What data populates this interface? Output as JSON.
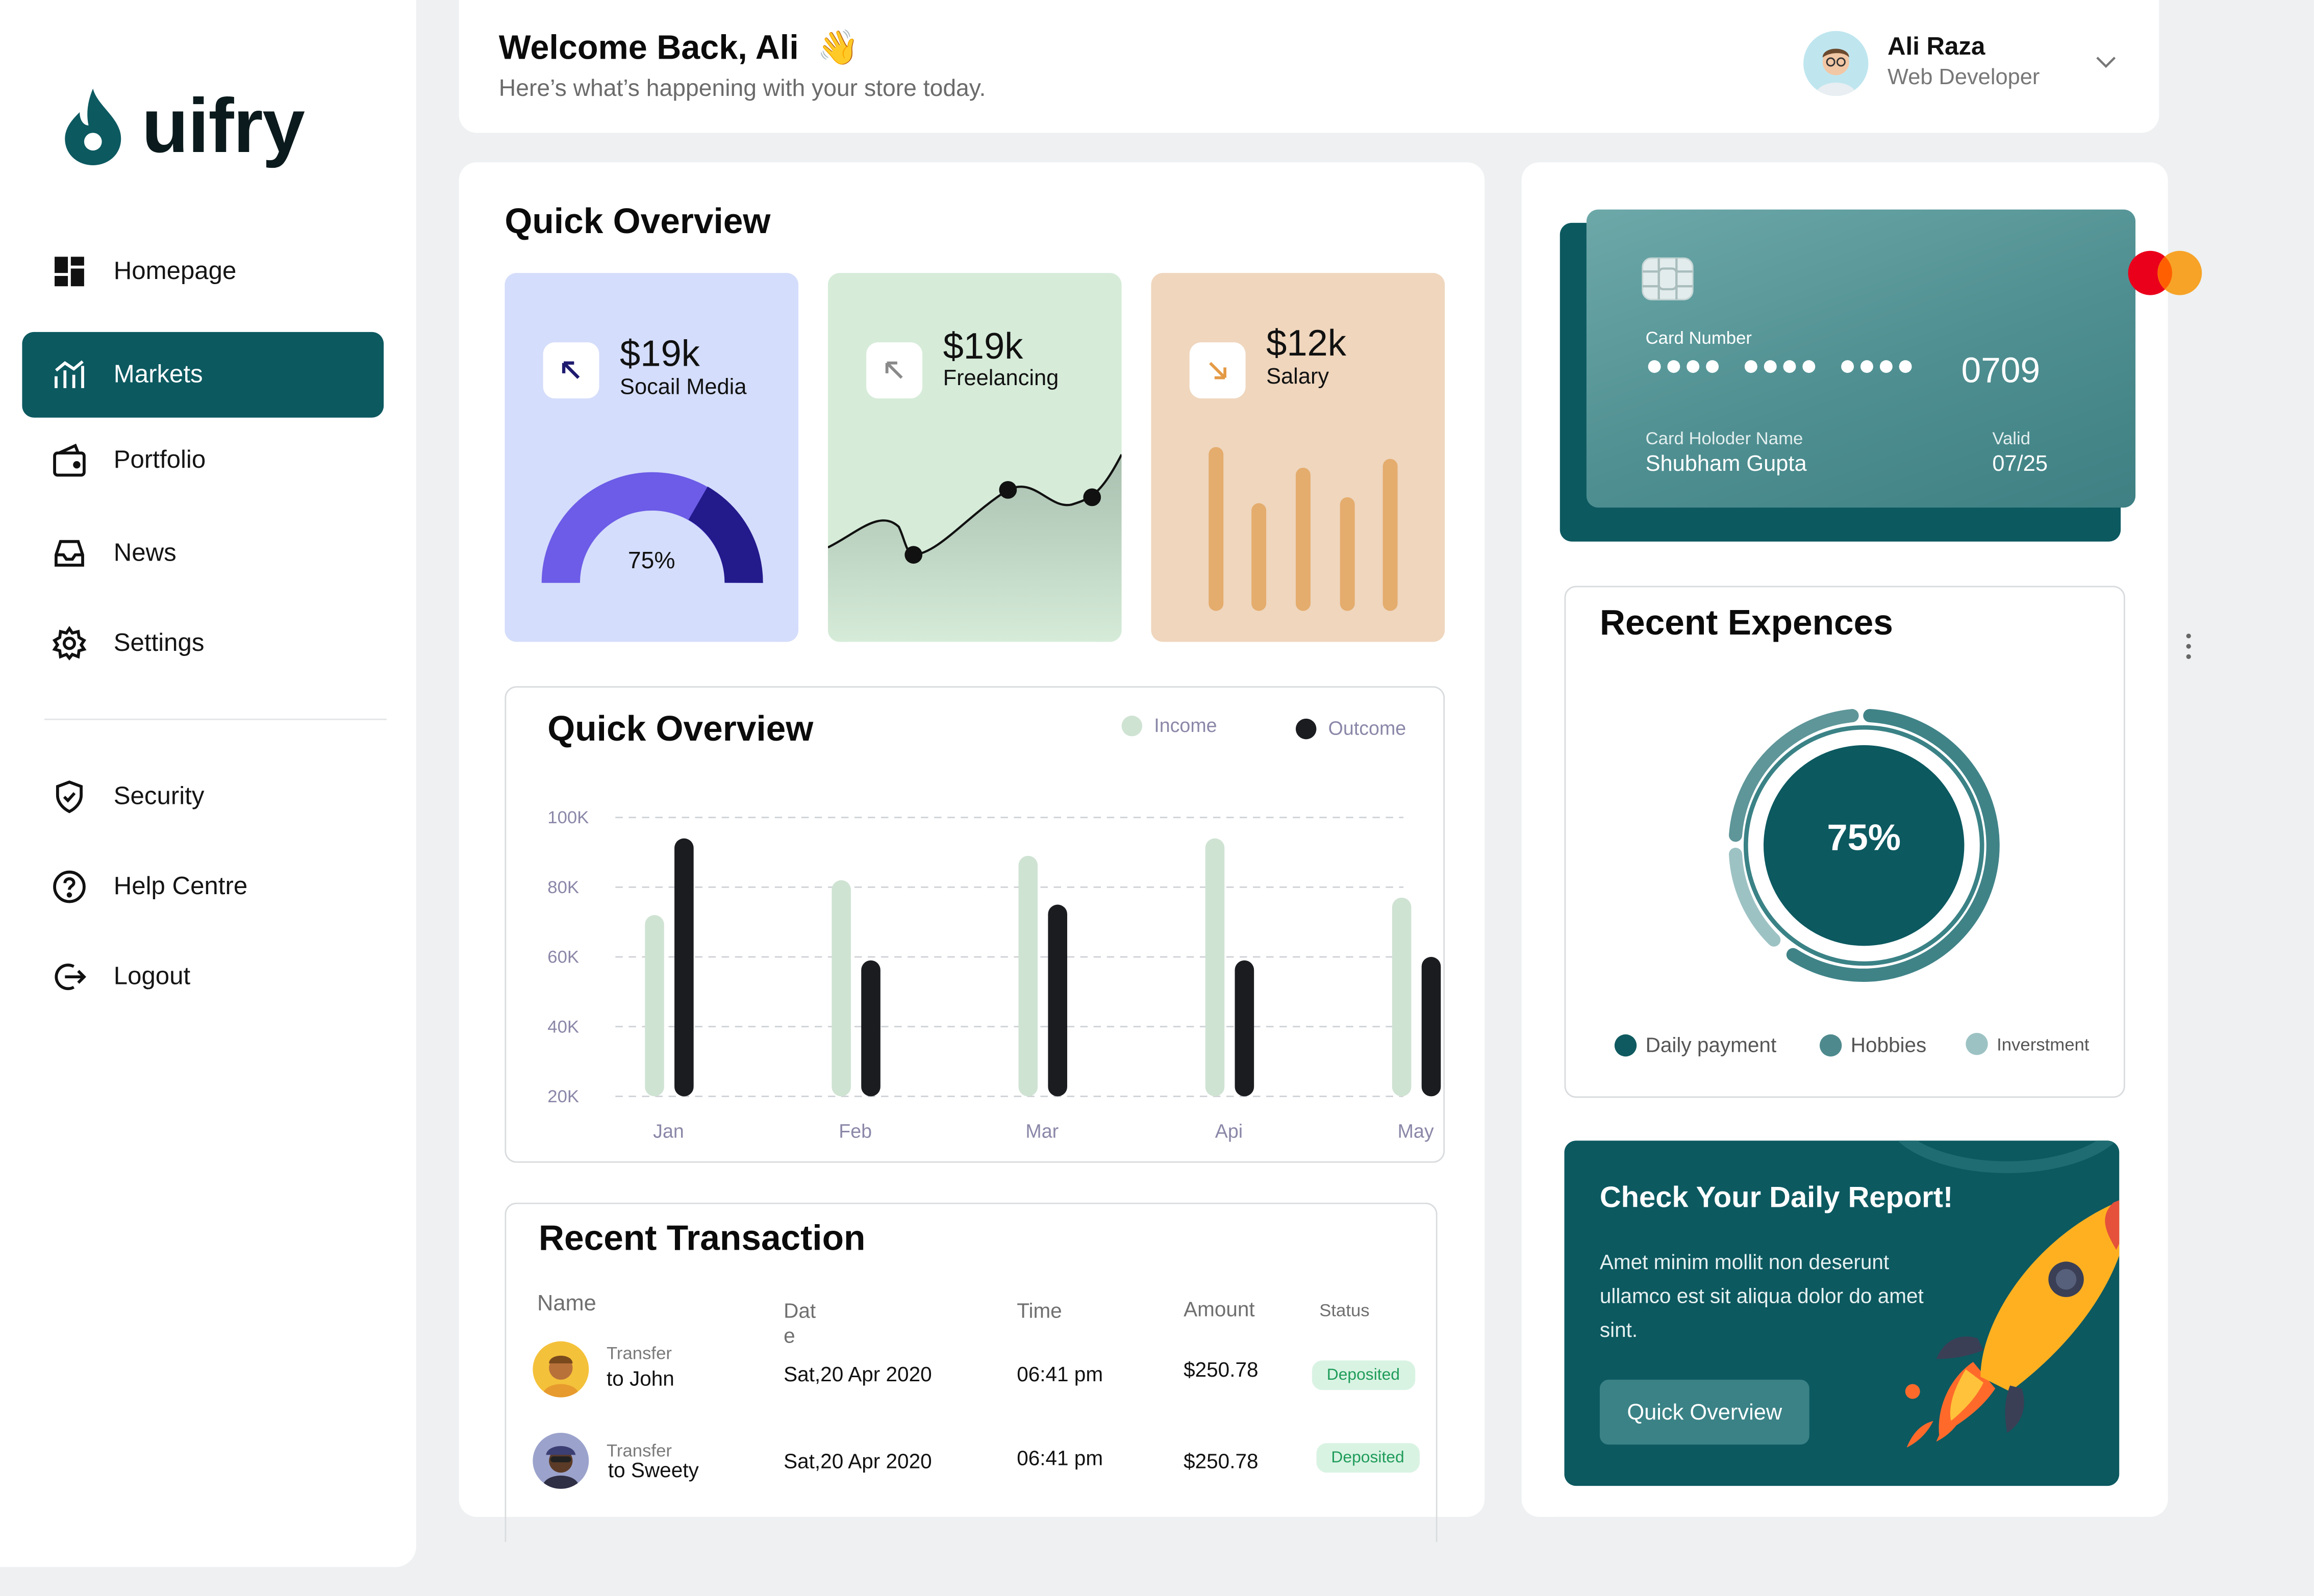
{
  "brand": {
    "name": "uifry"
  },
  "sidebar": {
    "items": [
      {
        "label": "Homepage",
        "icon": "grid-icon"
      },
      {
        "label": "Markets",
        "icon": "chart-icon",
        "active": true
      },
      {
        "label": "Portfolio",
        "icon": "wallet-icon"
      },
      {
        "label": "News",
        "icon": "inbox-icon"
      },
      {
        "label": "Settings",
        "icon": "gear-icon"
      },
      {
        "label": "Security",
        "icon": "shield-icon"
      },
      {
        "label": "Help Centre",
        "icon": "help-icon"
      },
      {
        "label": "Logout",
        "icon": "logout-icon"
      }
    ]
  },
  "header": {
    "welcome": "Welcome Back, Ali",
    "wave": "👋",
    "subtitle": "Here’s what’s happening with your store today.",
    "user": {
      "name": "Ali Raza",
      "role": "Web Developer"
    }
  },
  "overview": {
    "title": "Quick Overview",
    "cards": [
      {
        "value": "$19k",
        "label": "Socail Media",
        "gauge": "75%",
        "bg": "#d4ddfb"
      },
      {
        "value": "$19k",
        "label": "Freelancing",
        "bg": "#d6ecd9"
      },
      {
        "value": "$12k",
        "label": "Salary",
        "bg": "#efd6bd"
      }
    ]
  },
  "chart_data": {
    "type": "bar",
    "title": "Quick Overview",
    "categories": [
      "Jan",
      "Feb",
      "Mar",
      "Api",
      "May"
    ],
    "series": [
      {
        "name": "Income",
        "color": "#cfe3d3",
        "values": [
          72000,
          82000,
          89000,
          94000,
          77000
        ]
      },
      {
        "name": "Outcome",
        "color": "#1a1c20",
        "values": [
          94000,
          59000,
          75000,
          59000,
          60000
        ]
      }
    ],
    "yticks": [
      "100K",
      "80K",
      "60K",
      "40K",
      "20K"
    ],
    "ylim": [
      20000,
      100000
    ],
    "grid": true,
    "legend": "top-right"
  },
  "transactions": {
    "title": "Recent Transaction",
    "headers": {
      "name": "Name",
      "date": "Dat\ne",
      "time": "Time",
      "amount": "Amount",
      "status": "Status"
    },
    "rows": [
      {
        "prefix": "Transfer",
        "name": "to John",
        "date": "Sat,20 Apr 2020",
        "time": "06:41 pm",
        "amount": "$250.78",
        "status": "Deposited"
      },
      {
        "prefix": "Transfer",
        "name": "to Sweety",
        "date": "Sat,20 Apr 2020",
        "time": "06:41 pm",
        "amount": "$250.78",
        "status": "Deposited"
      }
    ]
  },
  "card": {
    "number_label": "Card Number",
    "last4": "0709",
    "holder_label": "Card Holoder Name",
    "holder": "Shubham Gupta",
    "valid_label": "Valid",
    "valid": "07/25"
  },
  "expenses": {
    "title": "Recent Expences",
    "percent": "75%",
    "legend": [
      {
        "label": "Daily payment",
        "color": "#0f5a60"
      },
      {
        "label": "Hobbies",
        "color": "#4e8a8d"
      },
      {
        "label": "Inverstment",
        "color": "#9dc2c4"
      }
    ]
  },
  "report": {
    "title": "Check Your Daily Report!",
    "body": "Amet minim mollit non deserunt ullamco est sit aliqua dolor do amet sint.",
    "button": "Quick Overview"
  }
}
